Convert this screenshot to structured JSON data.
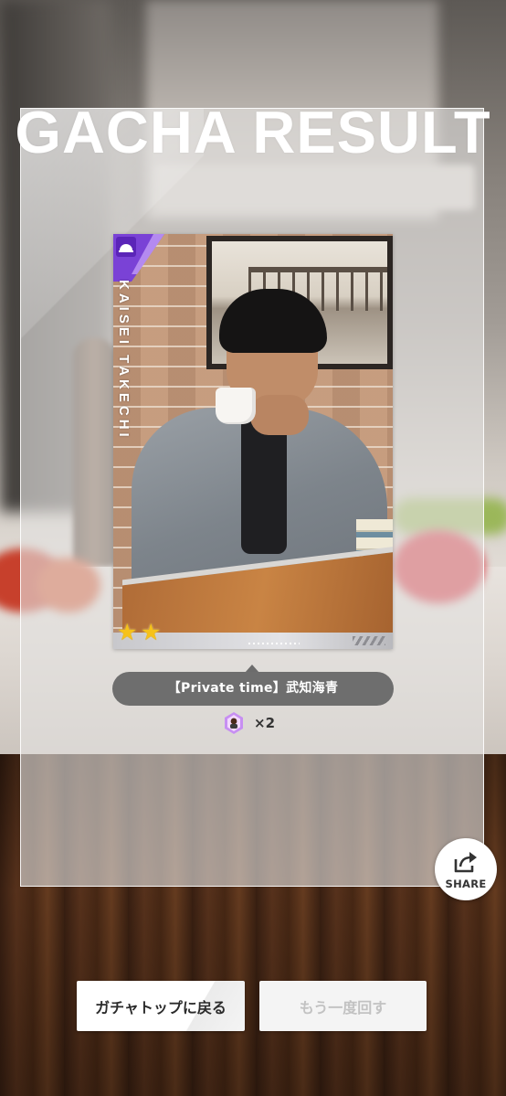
{
  "header": {
    "title": "GACHA RESULT"
  },
  "card": {
    "name_vertical": "KAISEI TAKECHI",
    "rarity_stars": 2,
    "badge_icon": "rank-badge-icon"
  },
  "result": {
    "name_plate": "【Private time】武知海青",
    "reward_icon": "character-token-icon",
    "reward_count": "×2"
  },
  "share": {
    "label": "SHARE",
    "icon": "share-arrow-icon"
  },
  "buttons": {
    "back_label": "ガチャトップに戻る",
    "retry_label": "もう一度回す"
  },
  "colors": {
    "name_plate_bg": "#6e6e6e",
    "star": "#f6c21a",
    "badge_purple": "#7a42d6"
  }
}
